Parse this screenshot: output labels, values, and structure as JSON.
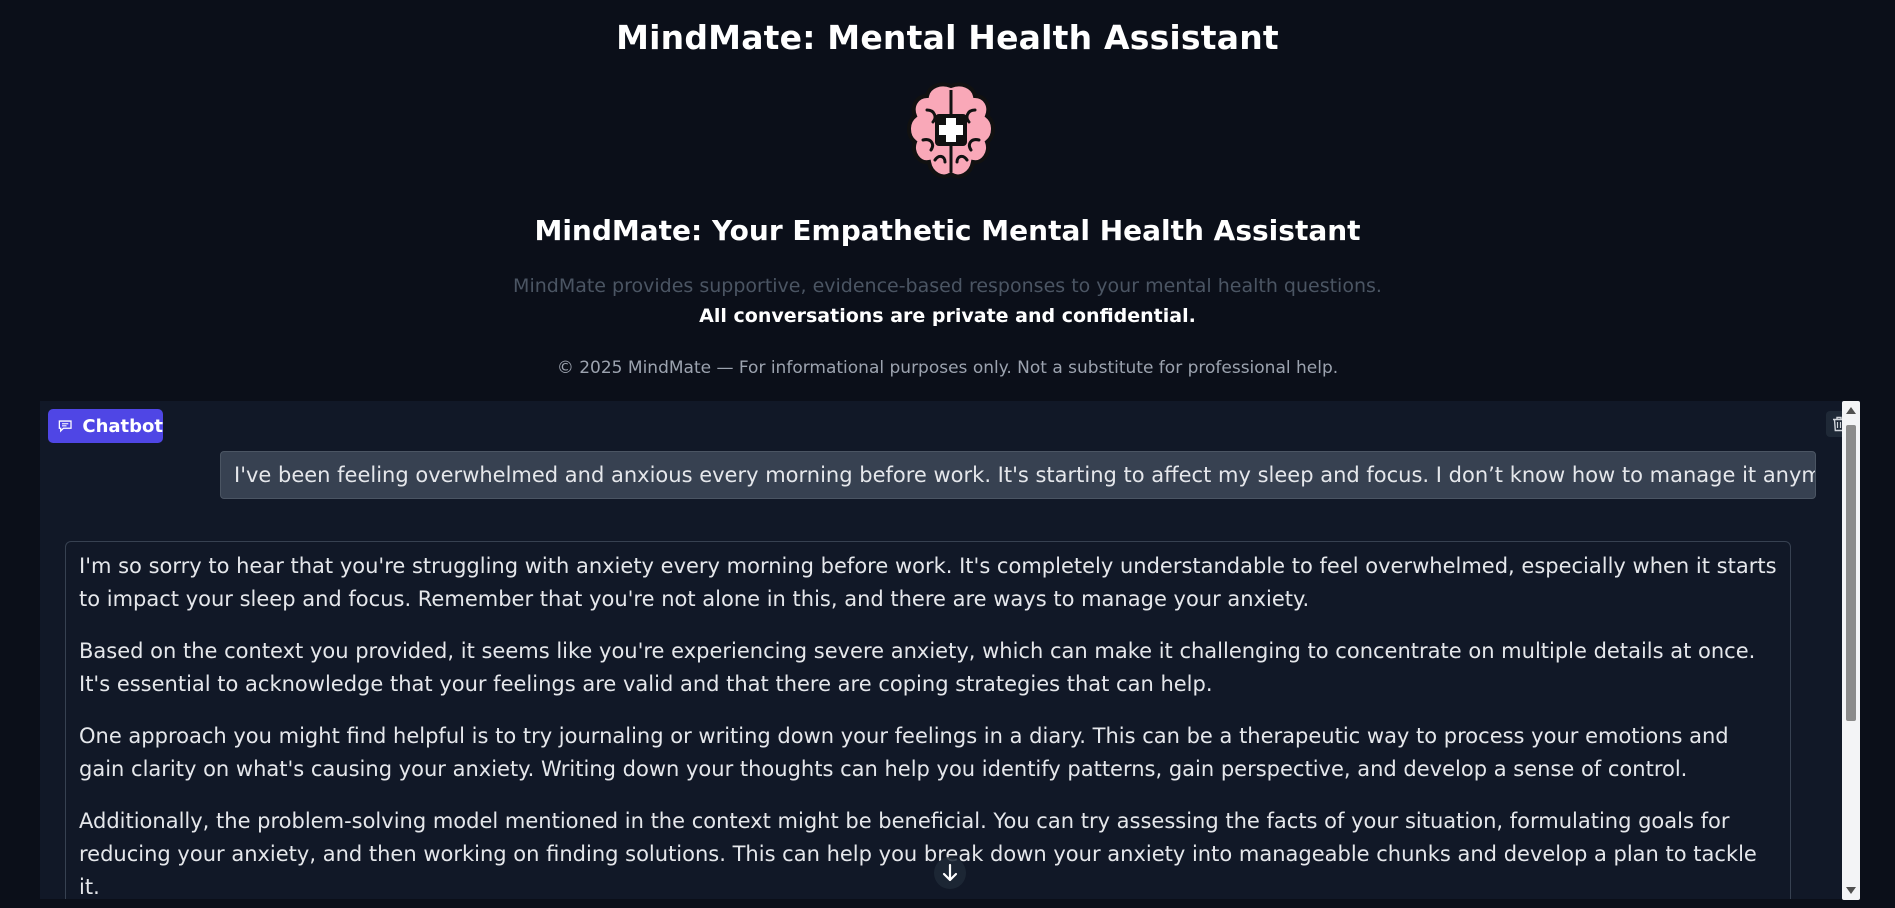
{
  "app": {
    "title": "MindMate: Mental Health Assistant",
    "subtitle": "MindMate: Your Empathetic Mental Health Assistant",
    "description": "MindMate provides supportive, evidence-based responses to your mental health questions.",
    "privacy_note": "All conversations are private and confidential.",
    "footer_note": "© 2025 MindMate — For informational purposes only. Not a substitute for professional help.",
    "logo_icon": "brain-medical-cross-icon"
  },
  "chatbot": {
    "label": "Chatbot",
    "label_icon": "chat-bubble-icon",
    "clear_icon": "trash-icon",
    "scroll_icon": "arrow-down-icon",
    "accent_color": "#4f46e5",
    "messages": [
      {
        "role": "user",
        "text": "I've been feeling overwhelmed and anxious every morning before work. It's starting to affect my sleep and focus. I don’t know how to manage it anymore."
      },
      {
        "role": "assistant",
        "paragraphs": [
          "I'm so sorry to hear that you're struggling with anxiety every morning before work. It's completely understandable to feel overwhelmed, especially when it starts to impact your sleep and focus. Remember that you're not alone in this, and there are ways to manage your anxiety.",
          "Based on the context you provided, it seems like you're experiencing severe anxiety, which can make it challenging to concentrate on multiple details at once. It's essential to acknowledge that your feelings are valid and that there are coping strategies that can help.",
          "One approach you might find helpful is to try journaling or writing down your feelings in a diary. This can be a therapeutic way to process your emotions and gain clarity on what's causing your anxiety. Writing down your thoughts can help you identify patterns, gain perspective, and develop a sense of control.",
          "Additionally, the problem-solving model mentioned in the context might be beneficial. You can try assessing the facts of your situation, formulating goals for reducing your anxiety, and then working on finding solutions. This can help you break down your anxiety into manageable chunks and develop a plan to tackle it."
        ]
      }
    ]
  }
}
